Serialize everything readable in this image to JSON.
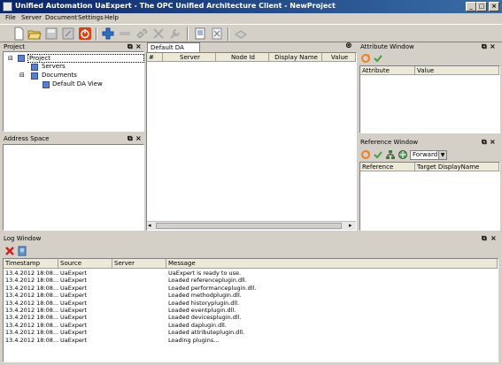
{
  "window": {
    "title": "Unified Automation UaExpert - The OPC Unified Architecture Client - NewProject"
  },
  "menu": [
    "File",
    "Server",
    "Document",
    "Settings",
    "Help"
  ],
  "project_panel": {
    "title": "Project",
    "tree": {
      "root": "Project",
      "servers": "Servers",
      "documents": "Documents",
      "da_view": "Default DA View"
    }
  },
  "address_space_panel": {
    "title": "Address Space"
  },
  "da_view": {
    "tab": "Default DA View",
    "columns": [
      "#",
      "Server",
      "Node Id",
      "Display Name",
      "Value"
    ]
  },
  "attribute_window": {
    "title": "Attribute Window",
    "columns": [
      "Attribute",
      "Value"
    ]
  },
  "reference_window": {
    "title": "Reference Window",
    "direction": "Forward",
    "columns": [
      "Reference",
      "Target DisplayName"
    ]
  },
  "log_window": {
    "title": "Log Window",
    "columns": [
      "Timestamp",
      "Source",
      "Server",
      "Message"
    ],
    "rows": [
      {
        "timestamp": "13.4.2012 18:08...",
        "source": "UaExpert",
        "server": "",
        "message": "UaExpert is ready to use."
      },
      {
        "timestamp": "13.4.2012 18:08...",
        "source": "UaExpert",
        "server": "",
        "message": "Loaded referenceplugin.dll."
      },
      {
        "timestamp": "13.4.2012 18:08...",
        "source": "UaExpert",
        "server": "",
        "message": "Loaded performanceplugin.dll."
      },
      {
        "timestamp": "13.4.2012 18:08...",
        "source": "UaExpert",
        "server": "",
        "message": "Loaded methodplugin.dll."
      },
      {
        "timestamp": "13.4.2012 18:08...",
        "source": "UaExpert",
        "server": "",
        "message": "Loaded historyplugin.dll."
      },
      {
        "timestamp": "13.4.2012 18:08...",
        "source": "UaExpert",
        "server": "",
        "message": "Loaded eventplugin.dll."
      },
      {
        "timestamp": "13.4.2012 18:08...",
        "source": "UaExpert",
        "server": "",
        "message": "Loaded devicesplugin.dll."
      },
      {
        "timestamp": "13.4.2012 18:08...",
        "source": "UaExpert",
        "server": "",
        "message": "Loaded daplugin.dll."
      },
      {
        "timestamp": "13.4.2012 18:08...",
        "source": "UaExpert",
        "server": "",
        "message": "Loaded attributeplugin.dll."
      },
      {
        "timestamp": "13.4.2012 18:08...",
        "source": "UaExpert",
        "server": "",
        "message": "Loading plugins..."
      }
    ]
  },
  "colors": {
    "title_bar_start": "#0a246a",
    "title_bar_end": "#3a6ea5",
    "chrome": "#d4d0c8",
    "stop_red": "#e04010",
    "refresh_orange": "#f08020",
    "check_green": "#40a040"
  }
}
